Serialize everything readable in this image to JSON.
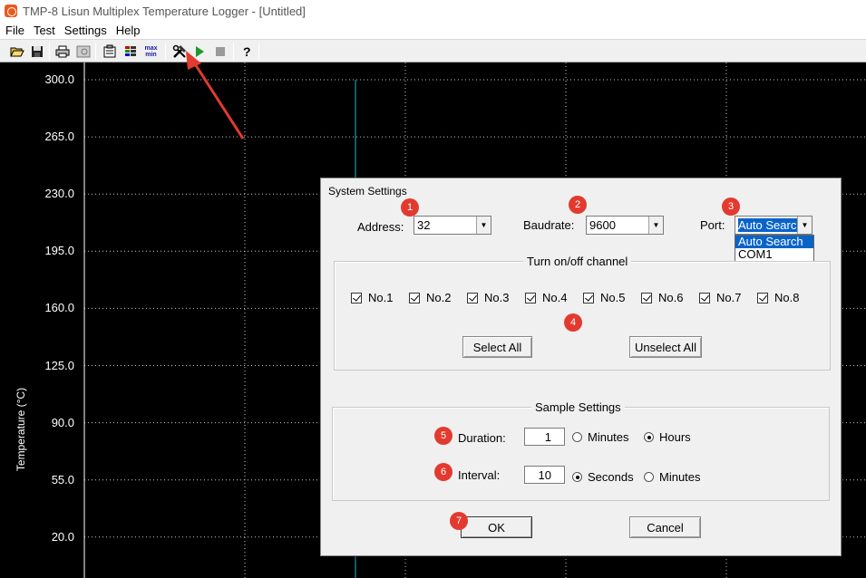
{
  "window": {
    "title": "TMP-8 Lisun Multiplex Temperature Logger - [Untitled]"
  },
  "menu": [
    {
      "label": "File"
    },
    {
      "label": "Test"
    },
    {
      "label": "Settings"
    },
    {
      "label": "Help"
    }
  ],
  "toolbar": {
    "buttons": [
      {
        "icon": "open-folder-icon"
      },
      {
        "icon": "save-icon"
      },
      {
        "icon": "print-icon"
      },
      {
        "icon": "print-preview-icon"
      },
      {
        "icon": "properties-icon"
      },
      {
        "icon": "channel-list-icon"
      },
      {
        "icon": "max-min-icon"
      },
      {
        "icon": "tools-icon"
      },
      {
        "icon": "play-icon"
      },
      {
        "icon": "stop-icon"
      },
      {
        "icon": "help-icon"
      }
    ],
    "maxmin_label": "max min"
  },
  "chart": {
    "y_ticks": [
      "300.0",
      "265.0",
      "230.0",
      "195.0",
      "160.0",
      "125.0",
      "90.0",
      "55.0",
      "20.0"
    ],
    "y_axis_title": "Temperature (°C)",
    "background": "#000000",
    "grid_color": "#c8c8c8",
    "cursor_color": "#2ab5d0"
  },
  "dialog": {
    "title": "System Settings",
    "address": {
      "label": "Address:",
      "value": "32"
    },
    "baudrate": {
      "label": "Baudrate:",
      "value": "9600"
    },
    "port": {
      "label": "Port:",
      "value": "Auto Search",
      "options": [
        "Auto Search",
        "COM1"
      ]
    },
    "channels": {
      "group_title": "Turn on/off channel",
      "items": [
        {
          "label": "No.1",
          "checked": true
        },
        {
          "label": "No.2",
          "checked": true
        },
        {
          "label": "No.3",
          "checked": true
        },
        {
          "label": "No.4",
          "checked": true
        },
        {
          "label": "No.5",
          "checked": true
        },
        {
          "label": "No.6",
          "checked": true
        },
        {
          "label": "No.7",
          "checked": true
        },
        {
          "label": "No.8",
          "checked": true
        }
      ],
      "select_all": "Select All",
      "unselect_all": "Unselect All"
    },
    "sample": {
      "group_title": "Sample Settings",
      "duration": {
        "label": "Duration:",
        "value": "1",
        "options": [
          "Minutes",
          "Hours"
        ],
        "selected": "Hours"
      },
      "interval": {
        "label": "Interval:",
        "value": "10",
        "options": [
          "Seconds",
          "Minutes"
        ],
        "selected": "Seconds"
      }
    },
    "ok": "OK",
    "cancel": "Cancel"
  },
  "annotations": {
    "badges": [
      "1",
      "2",
      "3",
      "4",
      "5",
      "6",
      "7"
    ],
    "color": "#e33a2f"
  }
}
